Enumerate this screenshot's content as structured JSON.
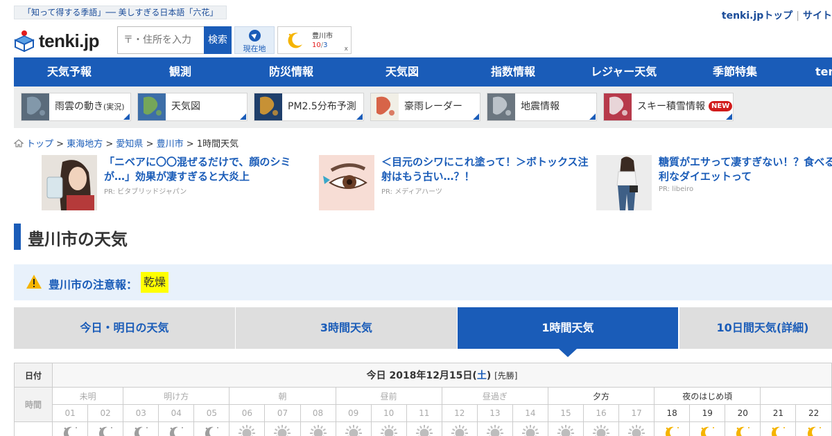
{
  "header": {
    "banner": "「知って得する季語」── 美しすぎる日本語「六花」",
    "top_link": "tenki.jpトップ",
    "site_link": "サイト",
    "logo_text": "tenki.jp",
    "search_placeholder": "〒・住所を入力",
    "search_button": "検索",
    "geo_button": "現在地",
    "pinned_city": "豊川市",
    "pinned_temp_high": "10",
    "pinned_temp_low": "3",
    "pinned_close": "x"
  },
  "nav": [
    {
      "label": "天気予報",
      "name": "nav-forecast"
    },
    {
      "label": "観測",
      "name": "nav-observation"
    },
    {
      "label": "防災情報",
      "name": "nav-disaster"
    },
    {
      "label": "天気図",
      "name": "nav-weather-map"
    },
    {
      "label": "指数情報",
      "name": "nav-index"
    },
    {
      "label": "レジャー天気",
      "name": "nav-leisure"
    },
    {
      "label": "季節特集",
      "name": "nav-season"
    },
    {
      "label": "ten",
      "name": "nav-more"
    }
  ],
  "quick_links": [
    {
      "label": "雨雲の動き",
      "sub": "(実況)",
      "icon": "rain-cloud-map-thumb"
    },
    {
      "label": "天気図",
      "sub": "",
      "icon": "weather-chart-thumb"
    },
    {
      "label": "PM2.5分布予測",
      "sub": "",
      "icon": "pm25-map-thumb"
    },
    {
      "label": "豪雨レーダー",
      "sub": "",
      "icon": "radar-map-thumb"
    },
    {
      "label": "地震情報",
      "sub": "",
      "icon": "earthquake-map-thumb"
    },
    {
      "label": "スキー積雪情報",
      "sub": "",
      "icon": "ski-photo-thumb",
      "badge": "NEW"
    }
  ],
  "breadcrumb": {
    "top": "トップ",
    "region": "東海地方",
    "pref": "愛知県",
    "city": "豊川市",
    "current": "1時間天気",
    "sep": ">"
  },
  "ads": [
    {
      "title": "「ニベアに〇〇混ぜるだけで、顔のシミが…」効果が凄すぎると大炎上",
      "pr": "PR: ビタブリッドジャパン"
    },
    {
      "title": "＜目元のシワにこれ塗って！＞ボトックス注射はもう古い…？！",
      "pr": "PR: メディアハーツ"
    },
    {
      "title": "糖質がエサって凄すぎない！？食べるほど有利なダイエットって",
      "pr": "PR: libeiro"
    }
  ],
  "page_title": "豊川市の天気",
  "alert": {
    "label": "豊川市の注意報：",
    "tag": "乾燥"
  },
  "tabs": [
    {
      "label": "今日・明日の天気",
      "active": false
    },
    {
      "label": "3時間天気",
      "active": false
    },
    {
      "label": "1時間天気",
      "active": true
    },
    {
      "label": "10日間天気(詳細)",
      "active": false
    }
  ],
  "table": {
    "date_header": "日付",
    "time_header": "時間",
    "date_prefix": "今日 2018年12月15日(",
    "day_of_week": "土",
    "date_suffix": ")",
    "rokuyo": "[先勝]",
    "periods": [
      {
        "label": "未明",
        "past": true
      },
      {
        "label": "明け方",
        "past": true
      },
      {
        "label": "朝",
        "past": true
      },
      {
        "label": "昼前",
        "past": true
      },
      {
        "label": "昼過ぎ",
        "past": true
      },
      {
        "label": "夕方",
        "past": false
      },
      {
        "label": "夜のはじめ頃",
        "past": false
      },
      {
        "label": "",
        "past": false
      }
    ],
    "hours": [
      "01",
      "02",
      "03",
      "04",
      "05",
      "06",
      "07",
      "08",
      "09",
      "10",
      "11",
      "12",
      "13",
      "14",
      "15",
      "16",
      "17",
      "18",
      "19",
      "20",
      "21",
      "22"
    ],
    "hours_past_until": 17,
    "icons": [
      "moon-clear-past",
      "moon-clear-past",
      "moon-clear-past",
      "moon-clear-past",
      "moon-clear-past",
      "sun-past",
      "sun-past",
      "sun-past",
      "sun-past",
      "sun-past",
      "sun-past",
      "sun-past",
      "sun-past",
      "sun-past",
      "sun-past",
      "sun-past",
      "sun-past",
      "moon-clear",
      "moon-clear",
      "moon-clear",
      "moon-clear",
      "moon-clear"
    ],
    "colors": {
      "sun_past": "#bdbdbd",
      "moon": "#f5b400",
      "moon_past": "#9e9e9e"
    }
  },
  "colors": {
    "brand": "#1a5cb8",
    "alert_bg": "#e8f1fb",
    "tag_yellow": "#ffff00",
    "badge_red": "#d11c1c"
  }
}
